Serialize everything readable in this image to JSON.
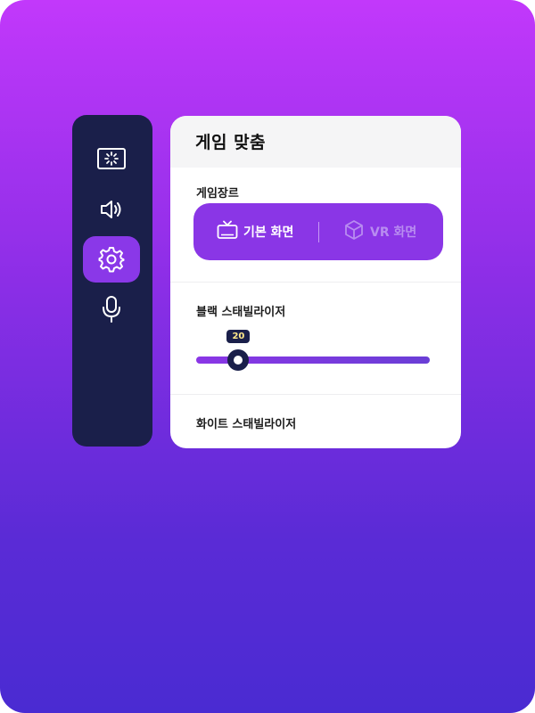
{
  "sidebar": {
    "items": [
      {
        "name": "display",
        "icon": "display-brightness-icon",
        "active": false
      },
      {
        "name": "sound",
        "icon": "speaker-icon",
        "active": false
      },
      {
        "name": "settings",
        "icon": "gear-icon",
        "active": true
      },
      {
        "name": "mic",
        "icon": "microphone-icon",
        "active": false
      }
    ]
  },
  "panel": {
    "title": "게임 맞춤",
    "genre": {
      "label": "게임장르",
      "options": [
        {
          "label": "기본 화면",
          "icon": "tv-icon",
          "selected": true
        },
        {
          "label": "VR 화면",
          "icon": "cube-icon",
          "selected": false
        }
      ]
    },
    "black_stabilizer": {
      "label": "블랙 스태빌라이저",
      "value": "20",
      "fraction": 0.12
    },
    "white_stabilizer": {
      "label": "화이트 스태빌라이저"
    }
  },
  "colors": {
    "accent": "#8a36e6",
    "dark": "#1a1f4a",
    "badge_text": "#ffe98a"
  }
}
